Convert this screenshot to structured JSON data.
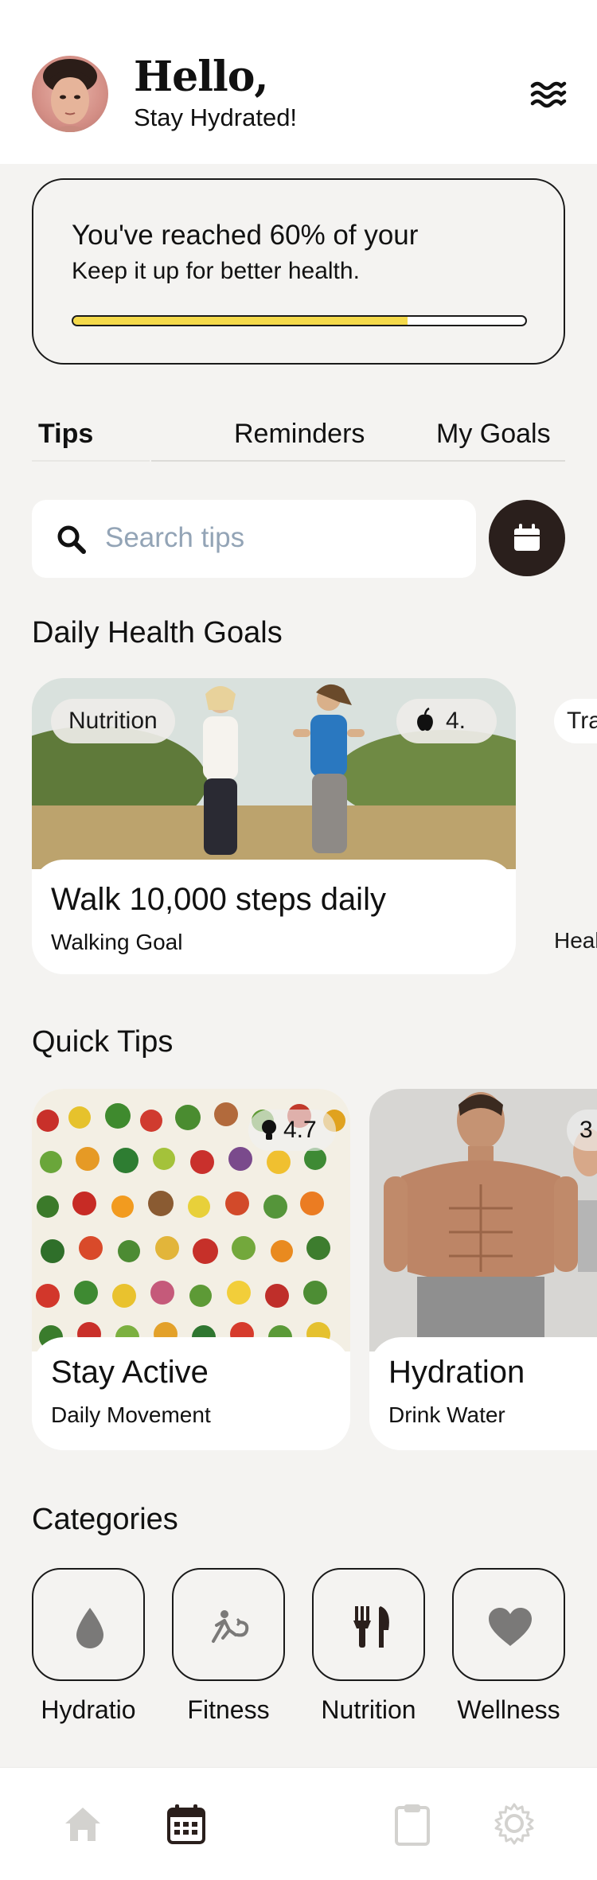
{
  "header": {
    "greeting": "Hello,",
    "subtitle": "Stay Hydrated!"
  },
  "progress": {
    "title": "You've reached 60% of your",
    "subtitle": "Keep it up for better health.",
    "percent": 0.74,
    "fill_color": "#f4d94a"
  },
  "tabs": [
    {
      "label": "Tips",
      "active": true
    },
    {
      "label": "Reminders",
      "active": false
    },
    {
      "label": "My Goals",
      "active": false
    }
  ],
  "search": {
    "placeholder": "Search tips"
  },
  "daily_goals": {
    "title": "Daily Health Goals",
    "cards": [
      {
        "badge": "Nutrition",
        "rating": "4.",
        "title": "Walk 10,000 steps daily",
        "subtitle": "Walking Goal"
      },
      {
        "badge": "Tra",
        "subtitle": "Heal"
      }
    ]
  },
  "quick_tips": {
    "title": "Quick Tips",
    "cards": [
      {
        "rating": "4.7",
        "title": "Stay Active",
        "subtitle": "Daily Movement"
      },
      {
        "rating": "3",
        "title": "Hydration",
        "subtitle": "Drink Water"
      }
    ]
  },
  "categories": {
    "title": "Categories",
    "items": [
      {
        "label": "Hydratio",
        "icon": "droplet-icon"
      },
      {
        "label": "Fitness",
        "icon": "running-icon"
      },
      {
        "label": "Nutrition",
        "icon": "utensils-icon"
      },
      {
        "label": "Wellness",
        "icon": "heart-icon"
      }
    ]
  },
  "bottom_nav": [
    {
      "icon": "home-icon"
    },
    {
      "icon": "calendar-icon"
    },
    {
      "icon": "clipboard-icon"
    },
    {
      "icon": "gear-icon"
    }
  ],
  "colors": {
    "background": "#f4f3f1",
    "accent_dark": "#2a1f1c",
    "progress_fill": "#f4d94a",
    "placeholder": "#93a4b6"
  }
}
